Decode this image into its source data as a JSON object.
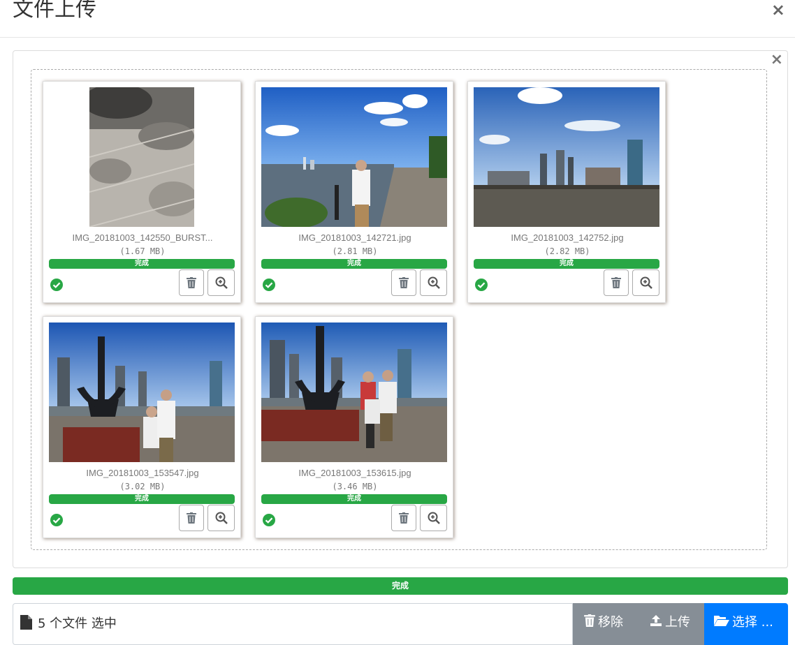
{
  "modal": {
    "title": "文件上传",
    "close_glyph": "×"
  },
  "panel": {
    "close_glyph": "×"
  },
  "files": [
    {
      "name": "IMG_20181003_142550_BURST...",
      "size": "(1.67 MB)",
      "status": "完成",
      "progress": 1.0
    },
    {
      "name": "IMG_20181003_142721.jpg",
      "size": "(2.81 MB)",
      "status": "完成",
      "progress": 1.0
    },
    {
      "name": "IMG_20181003_142752.jpg",
      "size": "(2.82 MB)",
      "status": "完成",
      "progress": 1.0
    },
    {
      "name": "IMG_20181003_153547.jpg",
      "size": "(3.02 MB)",
      "status": "完成",
      "progress": 1.0
    },
    {
      "name": "IMG_20181003_153615.jpg",
      "size": "(3.46 MB)",
      "status": "完成",
      "progress": 1.0
    }
  ],
  "total_progress": {
    "label": "完成",
    "value": 1.0
  },
  "footer": {
    "caption": "5 个文件 选中",
    "remove_label": "移除",
    "upload_label": "上传",
    "select_label": "选择 ..."
  },
  "colors": {
    "success": "#28a745",
    "primary": "#007bff",
    "secondary": "#868e96"
  },
  "icons": [
    "close-icon",
    "check-circle-icon",
    "trash-icon",
    "zoom-in-icon",
    "file-icon",
    "upload-icon",
    "folder-open-icon"
  ]
}
